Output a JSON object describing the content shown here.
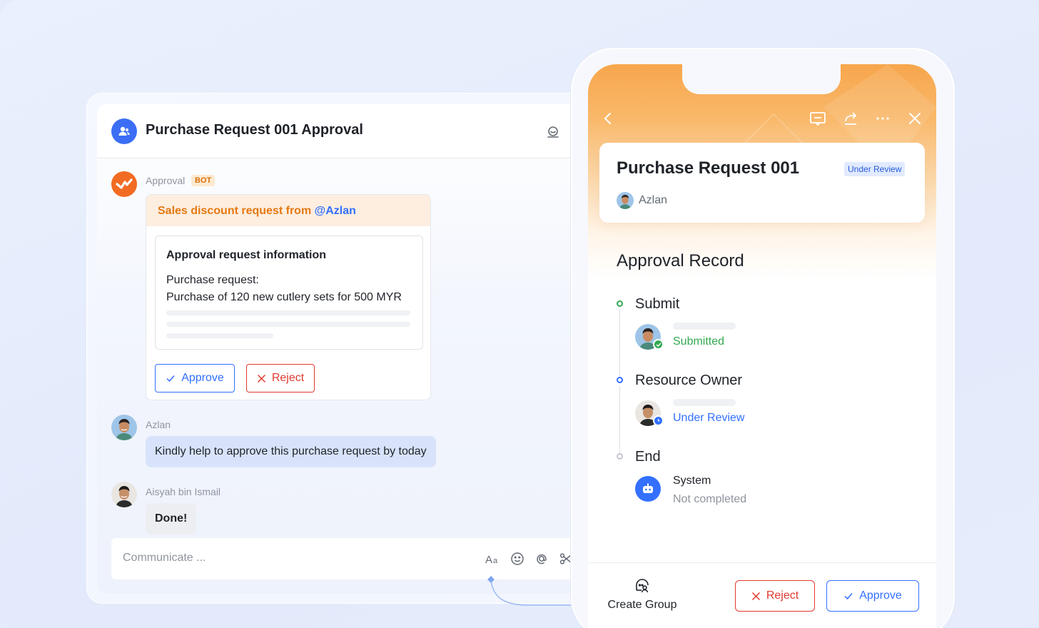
{
  "chat": {
    "title": "Purchase Request 001 Approval",
    "bot": {
      "name": "Approval",
      "tag": "BOT",
      "card_head_prefix": "Sales discount request from ",
      "card_head_mention": "@Azlan",
      "info_title": "Approval request information",
      "info_label": "Purchase request:",
      "info_value": "Purchase of 120 new cutlery sets for 500 MYR",
      "approve_label": "Approve",
      "reject_label": "Reject"
    },
    "messages": [
      {
        "name": "Azlan",
        "text": "Kindly help to approve this purchase request by today"
      },
      {
        "name": "Aisyah bin Ismail",
        "text": "Done!"
      }
    ],
    "composer": {
      "placeholder": "Communicate ..."
    }
  },
  "mobile": {
    "request_title": "Purchase Request 001",
    "status_badge": "Under Review",
    "requester": "Azlan",
    "record_title": "Approval Record",
    "timeline": [
      {
        "title": "Submit",
        "status": "Submitted",
        "status_color": "#34a853"
      },
      {
        "title": "Resource Owner",
        "status": "Under Review",
        "status_color": "#3370ff"
      },
      {
        "title": "End",
        "actor": "System",
        "status": "Not completed",
        "status_color": "#8f959e"
      }
    ],
    "create_group_label": "Create Group",
    "reject_label": "Reject",
    "approve_label": "Approve"
  },
  "colors": {
    "primary": "#3370ff",
    "danger": "#e03a2f",
    "success": "#34a853",
    "bot_orange": "#f26b22"
  }
}
